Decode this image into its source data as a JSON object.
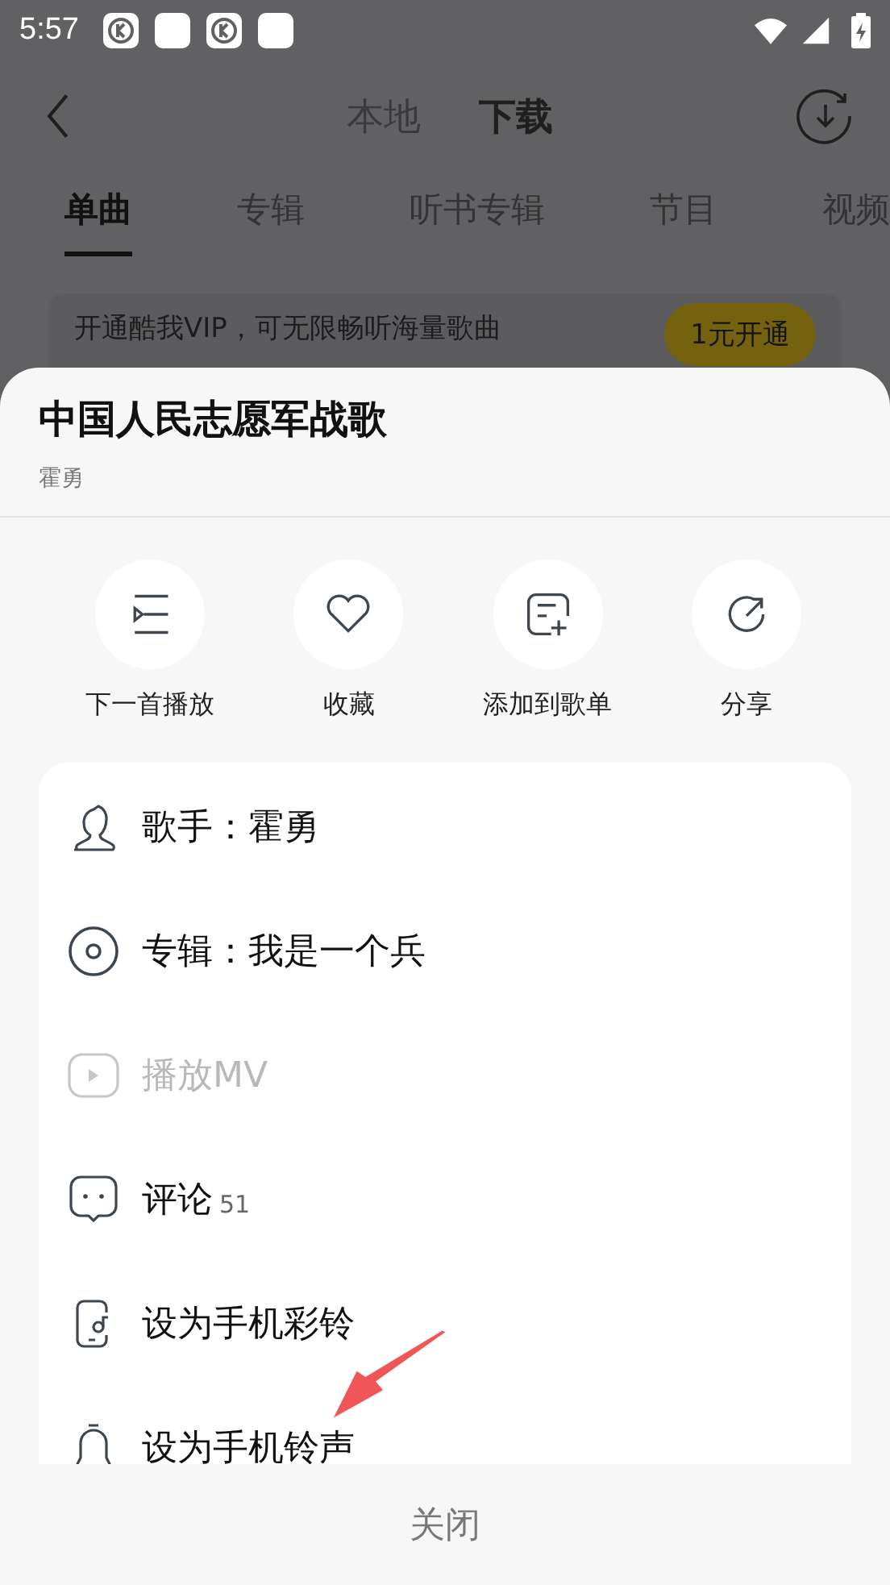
{
  "status_bar": {
    "time": "5:57",
    "notifications": [
      {
        "kind": "k"
      },
      {
        "kind": "blank"
      },
      {
        "kind": "k"
      },
      {
        "kind": "blank"
      }
    ]
  },
  "header": {
    "tabs": [
      {
        "label": "本地",
        "selected": false
      },
      {
        "label": "下载",
        "selected": true
      }
    ]
  },
  "category_tabs": [
    {
      "label": "单曲",
      "selected": true
    },
    {
      "label": "专辑",
      "selected": false
    },
    {
      "label": "听书专辑",
      "selected": false
    },
    {
      "label": "节目",
      "selected": false
    },
    {
      "label": "视频",
      "selected": false
    }
  ],
  "vip_banner": {
    "text": "开通酷我VIP，可无限畅听海量歌曲",
    "button": "1元开通"
  },
  "sheet": {
    "title": "中国人民志愿军战歌",
    "artist": "霍勇",
    "actions": [
      {
        "kind": "queue",
        "label": "下一首播放"
      },
      {
        "kind": "heart",
        "label": "收藏"
      },
      {
        "kind": "playlist-add",
        "label": "添加到歌单"
      },
      {
        "kind": "share",
        "label": "分享"
      }
    ],
    "menu": [
      {
        "kind": "person",
        "label": "歌手：霍勇",
        "disabled": false
      },
      {
        "kind": "disc",
        "label": "专辑：我是一个兵",
        "disabled": false
      },
      {
        "kind": "video",
        "label": "播放MV",
        "disabled": true
      },
      {
        "kind": "comment",
        "label": "评论",
        "count": "51",
        "disabled": false
      },
      {
        "kind": "phone-music",
        "label": "设为手机彩铃",
        "disabled": false
      },
      {
        "kind": "bell",
        "label": "设为手机铃声",
        "disabled": false
      }
    ],
    "close": "关闭"
  }
}
